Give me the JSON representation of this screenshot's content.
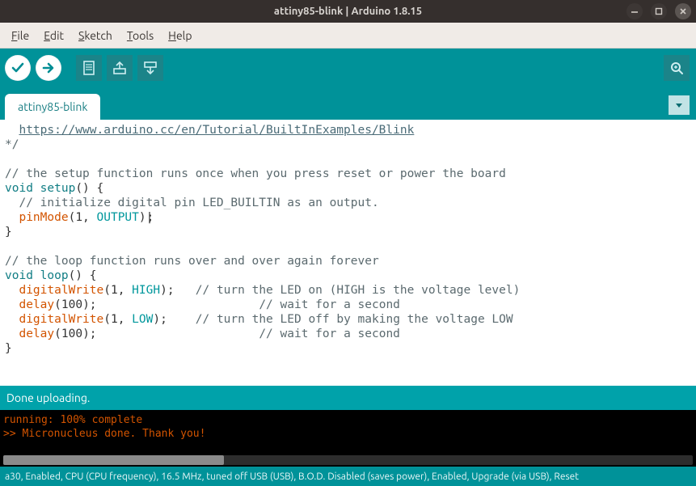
{
  "window": {
    "title": "attiny85-blink | Arduino 1.8.15"
  },
  "menu": {
    "file": "File",
    "edit": "Edit",
    "sketch": "Sketch",
    "tools": "Tools",
    "help": "Help"
  },
  "tabs": {
    "active": "attiny85-blink"
  },
  "code": {
    "url": "https://www.arduino.cc/en/Tutorial/BuiltInExamples/Blink",
    "end_comment": "*/",
    "setup_comment": "// the setup function runs once when you press reset or power the board",
    "kw_void": "void",
    "fn_setup": "setup",
    "setup_sig_tail": "() {",
    "init_comment": "  // initialize digital pin LED_BUILTIN as an output.",
    "fn_pinMode": "pinMode",
    "pin_num": "1",
    "const_OUTPUT": "OUTPUT",
    "close_brace": "}",
    "loop_comment": "// the loop function runs over and over again forever",
    "fn_loop": "loop",
    "loop_sig_tail": "() {",
    "fn_digitalWrite": "digitalWrite",
    "const_HIGH": "HIGH",
    "dw_high_comment": "   // turn the LED on (HIGH is the voltage level)",
    "fn_delay": "delay",
    "delay_val": "100",
    "delay1_comment": "                       // wait for a second",
    "const_LOW": "LOW",
    "dw_low_comment": "    // turn the LED off by making the voltage LOW",
    "delay2_comment": "                       // wait for a second"
  },
  "status": {
    "text": "Done uploading."
  },
  "console": {
    "line1": "running: 100% complete",
    "line2": ">> Micronucleus done. Thank you!"
  },
  "footer": {
    "text": "a30, Enabled, CPU (CPU frequency), 16.5 MHz, tuned off USB (USB), B.O.D. Disabled (saves power), Enabled, Upgrade (via USB), Reset"
  }
}
